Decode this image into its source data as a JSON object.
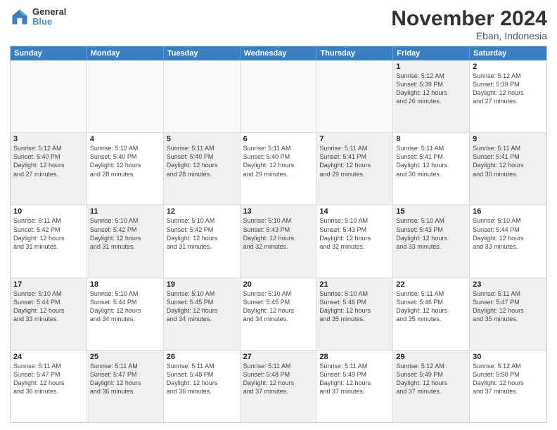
{
  "logo": {
    "general": "General",
    "blue": "Blue"
  },
  "title": "November 2024",
  "subtitle": "Eban, Indonesia",
  "header_days": [
    "Sunday",
    "Monday",
    "Tuesday",
    "Wednesday",
    "Thursday",
    "Friday",
    "Saturday"
  ],
  "rows": [
    [
      {
        "day": "",
        "info": "",
        "empty": true
      },
      {
        "day": "",
        "info": "",
        "empty": true
      },
      {
        "day": "",
        "info": "",
        "empty": true
      },
      {
        "day": "",
        "info": "",
        "empty": true
      },
      {
        "day": "",
        "info": "",
        "empty": true
      },
      {
        "day": "1",
        "info": "Sunrise: 5:12 AM\nSunset: 5:39 PM\nDaylight: 12 hours\nand 26 minutes.",
        "shaded": true
      },
      {
        "day": "2",
        "info": "Sunrise: 5:12 AM\nSunset: 5:39 PM\nDaylight: 12 hours\nand 27 minutes.",
        "shaded": false
      }
    ],
    [
      {
        "day": "3",
        "info": "Sunrise: 5:12 AM\nSunset: 5:40 PM\nDaylight: 12 hours\nand 27 minutes.",
        "shaded": true
      },
      {
        "day": "4",
        "info": "Sunrise: 5:12 AM\nSunset: 5:40 PM\nDaylight: 12 hours\nand 28 minutes.",
        "shaded": false
      },
      {
        "day": "5",
        "info": "Sunrise: 5:11 AM\nSunset: 5:40 PM\nDaylight: 12 hours\nand 28 minutes.",
        "shaded": true
      },
      {
        "day": "6",
        "info": "Sunrise: 5:11 AM\nSunset: 5:40 PM\nDaylight: 12 hours\nand 29 minutes.",
        "shaded": false
      },
      {
        "day": "7",
        "info": "Sunrise: 5:11 AM\nSunset: 5:41 PM\nDaylight: 12 hours\nand 29 minutes.",
        "shaded": true
      },
      {
        "day": "8",
        "info": "Sunrise: 5:11 AM\nSunset: 5:41 PM\nDaylight: 12 hours\nand 30 minutes.",
        "shaded": false
      },
      {
        "day": "9",
        "info": "Sunrise: 5:11 AM\nSunset: 5:41 PM\nDaylight: 12 hours\nand 30 minutes.",
        "shaded": true
      }
    ],
    [
      {
        "day": "10",
        "info": "Sunrise: 5:11 AM\nSunset: 5:42 PM\nDaylight: 12 hours\nand 31 minutes.",
        "shaded": false
      },
      {
        "day": "11",
        "info": "Sunrise: 5:10 AM\nSunset: 5:42 PM\nDaylight: 12 hours\nand 31 minutes.",
        "shaded": true
      },
      {
        "day": "12",
        "info": "Sunrise: 5:10 AM\nSunset: 5:42 PM\nDaylight: 12 hours\nand 31 minutes.",
        "shaded": false
      },
      {
        "day": "13",
        "info": "Sunrise: 5:10 AM\nSunset: 5:43 PM\nDaylight: 12 hours\nand 32 minutes.",
        "shaded": true
      },
      {
        "day": "14",
        "info": "Sunrise: 5:10 AM\nSunset: 5:43 PM\nDaylight: 12 hours\nand 32 minutes.",
        "shaded": false
      },
      {
        "day": "15",
        "info": "Sunrise: 5:10 AM\nSunset: 5:43 PM\nDaylight: 12 hours\nand 33 minutes.",
        "shaded": true
      },
      {
        "day": "16",
        "info": "Sunrise: 5:10 AM\nSunset: 5:44 PM\nDaylight: 12 hours\nand 33 minutes.",
        "shaded": false
      }
    ],
    [
      {
        "day": "17",
        "info": "Sunrise: 5:10 AM\nSunset: 5:44 PM\nDaylight: 12 hours\nand 33 minutes.",
        "shaded": true
      },
      {
        "day": "18",
        "info": "Sunrise: 5:10 AM\nSunset: 5:44 PM\nDaylight: 12 hours\nand 34 minutes.",
        "shaded": false
      },
      {
        "day": "19",
        "info": "Sunrise: 5:10 AM\nSunset: 5:45 PM\nDaylight: 12 hours\nand 34 minutes.",
        "shaded": true
      },
      {
        "day": "20",
        "info": "Sunrise: 5:10 AM\nSunset: 5:45 PM\nDaylight: 12 hours\nand 34 minutes.",
        "shaded": false
      },
      {
        "day": "21",
        "info": "Sunrise: 5:10 AM\nSunset: 5:46 PM\nDaylight: 12 hours\nand 35 minutes.",
        "shaded": true
      },
      {
        "day": "22",
        "info": "Sunrise: 5:11 AM\nSunset: 5:46 PM\nDaylight: 12 hours\nand 35 minutes.",
        "shaded": false
      },
      {
        "day": "23",
        "info": "Sunrise: 5:11 AM\nSunset: 5:47 PM\nDaylight: 12 hours\nand 35 minutes.",
        "shaded": true
      }
    ],
    [
      {
        "day": "24",
        "info": "Sunrise: 5:11 AM\nSunset: 5:47 PM\nDaylight: 12 hours\nand 36 minutes.",
        "shaded": false
      },
      {
        "day": "25",
        "info": "Sunrise: 5:11 AM\nSunset: 5:47 PM\nDaylight: 12 hours\nand 36 minutes.",
        "shaded": true
      },
      {
        "day": "26",
        "info": "Sunrise: 5:11 AM\nSunset: 5:48 PM\nDaylight: 12 hours\nand 36 minutes.",
        "shaded": false
      },
      {
        "day": "27",
        "info": "Sunrise: 5:11 AM\nSunset: 5:48 PM\nDaylight: 12 hours\nand 37 minutes.",
        "shaded": true
      },
      {
        "day": "28",
        "info": "Sunrise: 5:11 AM\nSunset: 5:49 PM\nDaylight: 12 hours\nand 37 minutes.",
        "shaded": false
      },
      {
        "day": "29",
        "info": "Sunrise: 5:12 AM\nSunset: 5:49 PM\nDaylight: 12 hours\nand 37 minutes.",
        "shaded": true
      },
      {
        "day": "30",
        "info": "Sunrise: 5:12 AM\nSunset: 5:50 PM\nDaylight: 12 hours\nand 37 minutes.",
        "shaded": false
      }
    ]
  ]
}
